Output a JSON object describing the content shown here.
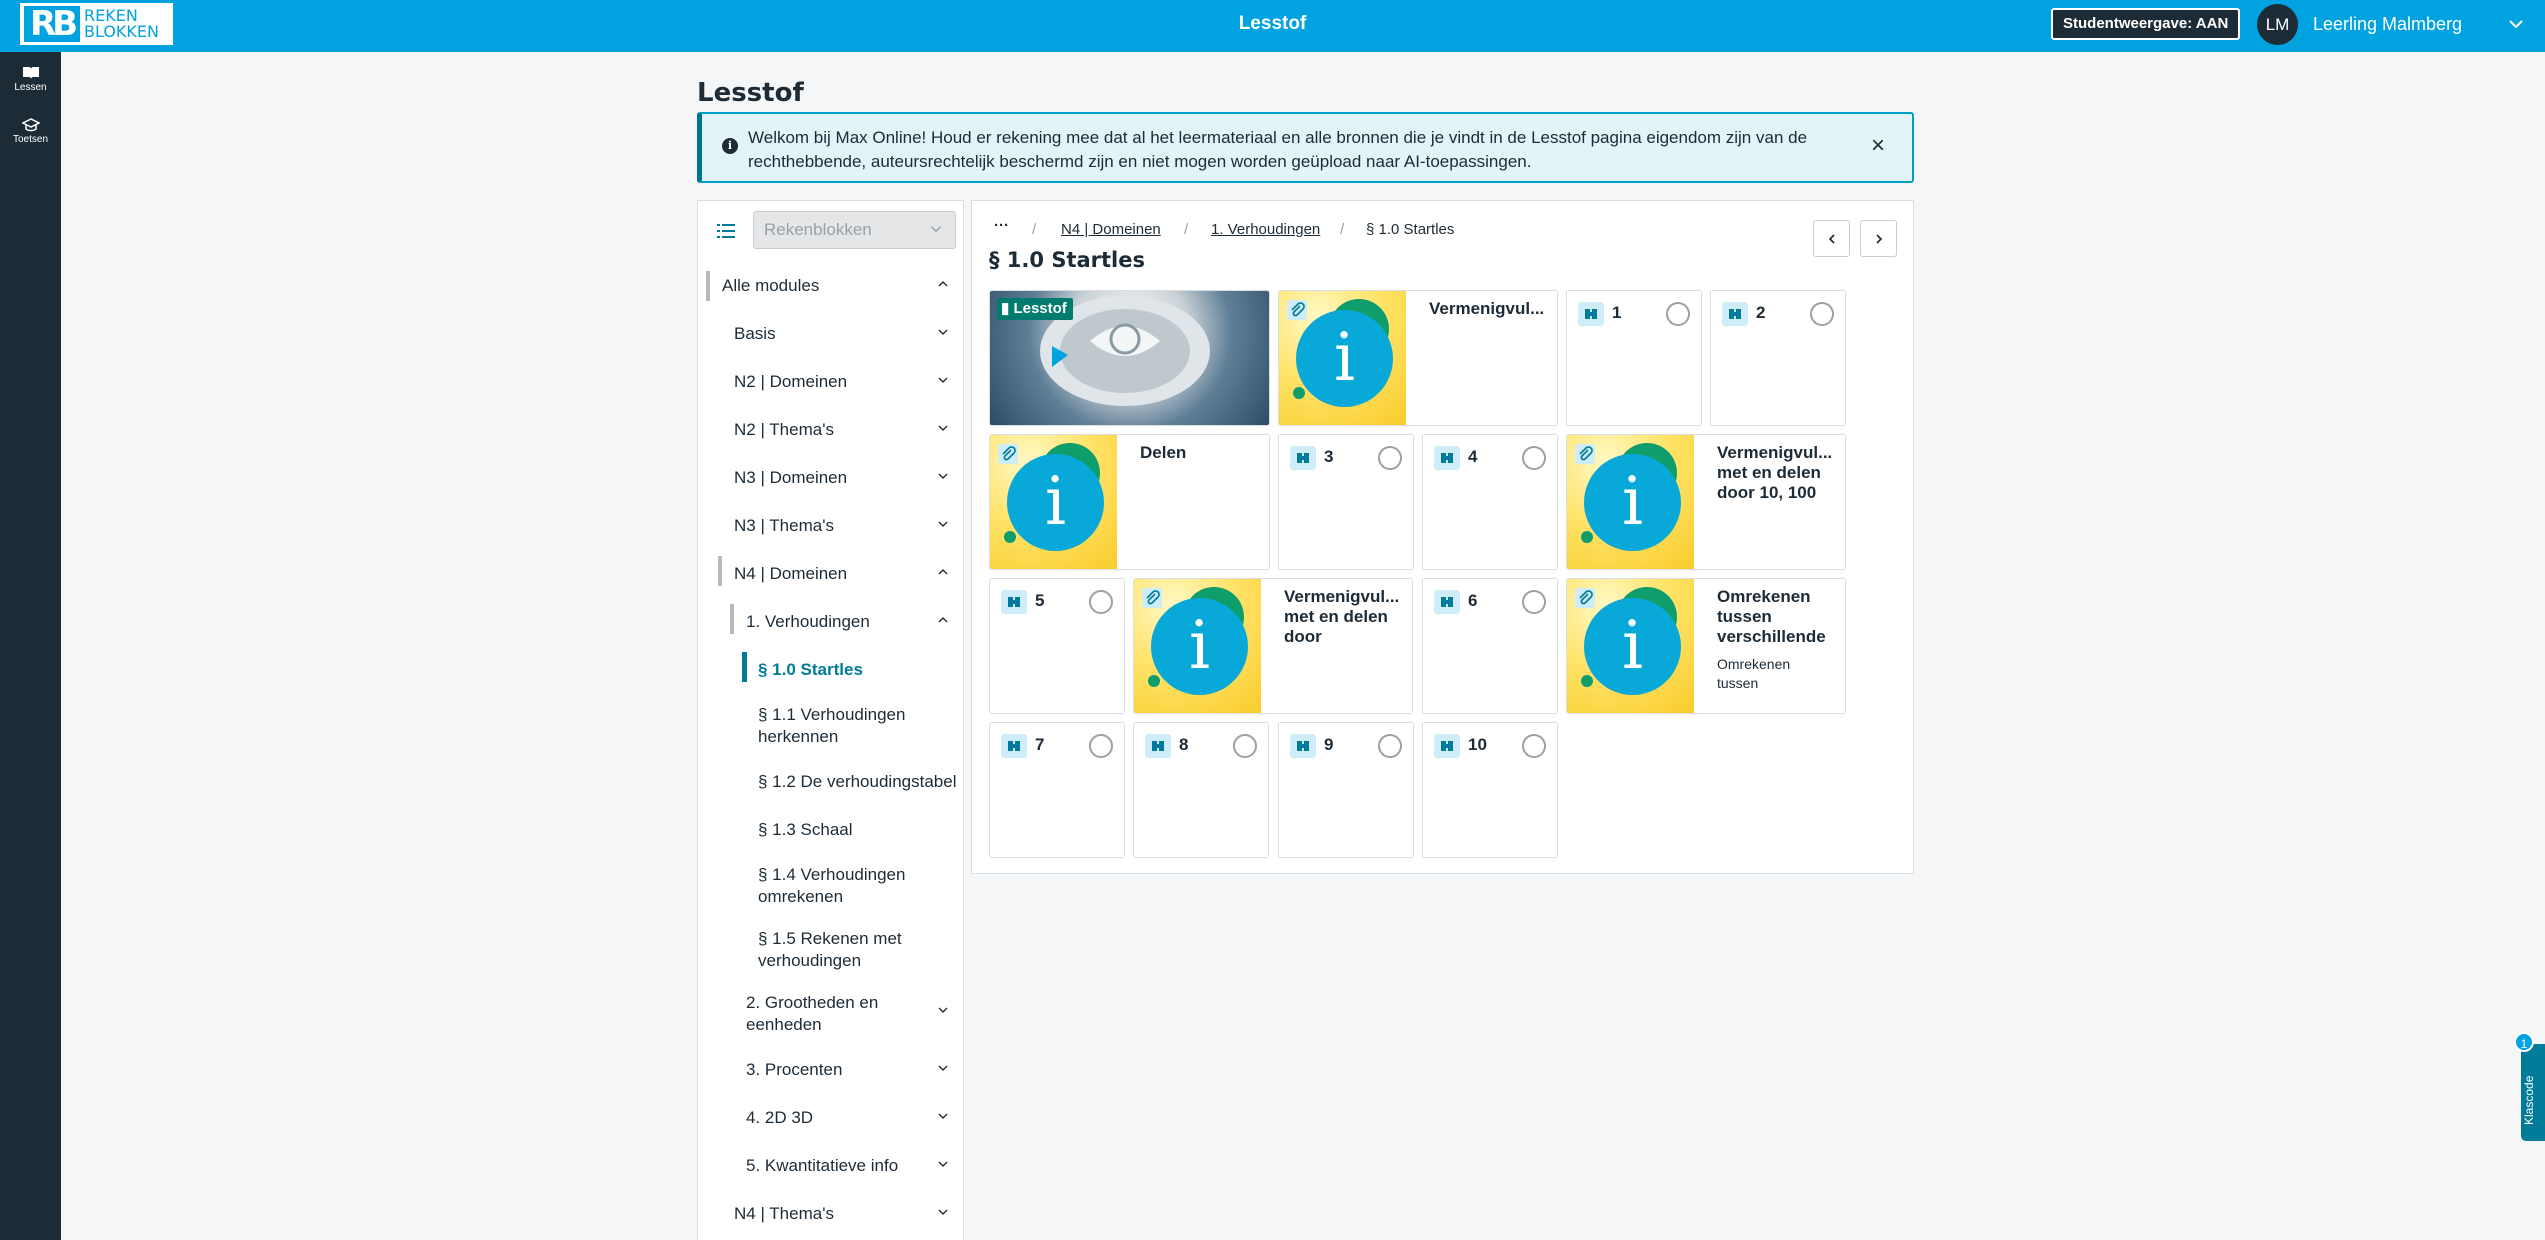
{
  "topbar": {
    "logo_mark": "RB",
    "logo_line1": "REKEN",
    "logo_line2": "BLOKKEN",
    "title": "Lesstof",
    "student_toggle": "Studentweergave: AAN",
    "user_initials": "LM",
    "user_name": "Leerling Malmberg",
    "color": "#00a3e0"
  },
  "rail": {
    "items": [
      {
        "label": "Lessen",
        "icon": "book-icon"
      },
      {
        "label": "Toetsen",
        "icon": "graduation-cap-icon"
      }
    ]
  },
  "page": {
    "title": "Lesstof",
    "alert": "Welkom bij Max Online! Houd er rekening mee dat al het leermateriaal en alle bronnen die je vindt in de Lesstof pagina eigendom zijn van de rechthebbende, auteursrechtelijk beschermd zijn en niet mogen worden geüpload naar AI-toepassingen."
  },
  "sidebar": {
    "select_value": "Rekenblokken",
    "items": [
      {
        "label": "Alle modules",
        "level": 0,
        "expanded": true
      },
      {
        "label": "Basis",
        "level": 1,
        "expanded": false
      },
      {
        "label": "N2 | Domeinen",
        "level": 1,
        "expanded": false
      },
      {
        "label": "N2 | Thema's",
        "level": 1,
        "expanded": false
      },
      {
        "label": "N3 | Domeinen",
        "level": 1,
        "expanded": false
      },
      {
        "label": "N3 | Thema's",
        "level": 1,
        "expanded": false
      },
      {
        "label": "N4 | Domeinen",
        "level": 1,
        "expanded": true
      },
      {
        "label": "1. Verhoudingen",
        "level": 2,
        "expanded": true
      },
      {
        "label": "§ 1.0 Startles",
        "level": 3,
        "active": true
      },
      {
        "label": "§ 1.1 Verhoudingen herkennen",
        "level": 3
      },
      {
        "label": "§ 1.2 De verhoudingstabel",
        "level": 3
      },
      {
        "label": "§ 1.3 Schaal",
        "level": 3
      },
      {
        "label": "§ 1.4 Verhoudingen omrekenen",
        "level": 3
      },
      {
        "label": "§ 1.5 Rekenen met verhoudingen",
        "level": 3
      },
      {
        "label": "2. Grootheden en eenheden",
        "level": 2,
        "expanded": false
      },
      {
        "label": "3. Procenten",
        "level": 2,
        "expanded": false
      },
      {
        "label": "4. 2D 3D",
        "level": 2,
        "expanded": false
      },
      {
        "label": "5. Kwantitatieve info",
        "level": 2,
        "expanded": false
      },
      {
        "label": "N4 | Thema's",
        "level": 1,
        "expanded": false
      }
    ]
  },
  "content": {
    "breadcrumb": {
      "ellipsis": "···",
      "items": [
        "N4 | Domeinen",
        "1. Verhoudingen",
        "§ 1.0 Startles"
      ],
      "separator": "/"
    },
    "section_title": "§ 1.0 Startles",
    "lesstof_badge": "Lesstof",
    "info_tiles": [
      {
        "title": "Vermenigvul...",
        "subtitle": ""
      },
      {
        "title": "Delen",
        "subtitle": ""
      },
      {
        "title": "Vermenigvul... met en delen door 10, 100",
        "subtitle": ""
      },
      {
        "title": "Vermenigvul... met en delen door",
        "subtitle": ""
      },
      {
        "title": "Omrekenen tussen verschillende",
        "subtitle": "Omrekenen tussen"
      }
    ],
    "exercises": [
      "1",
      "2",
      "3",
      "4",
      "5",
      "6",
      "7",
      "8",
      "9",
      "10"
    ]
  },
  "klascode": {
    "label": "Klascode",
    "count": "1"
  }
}
